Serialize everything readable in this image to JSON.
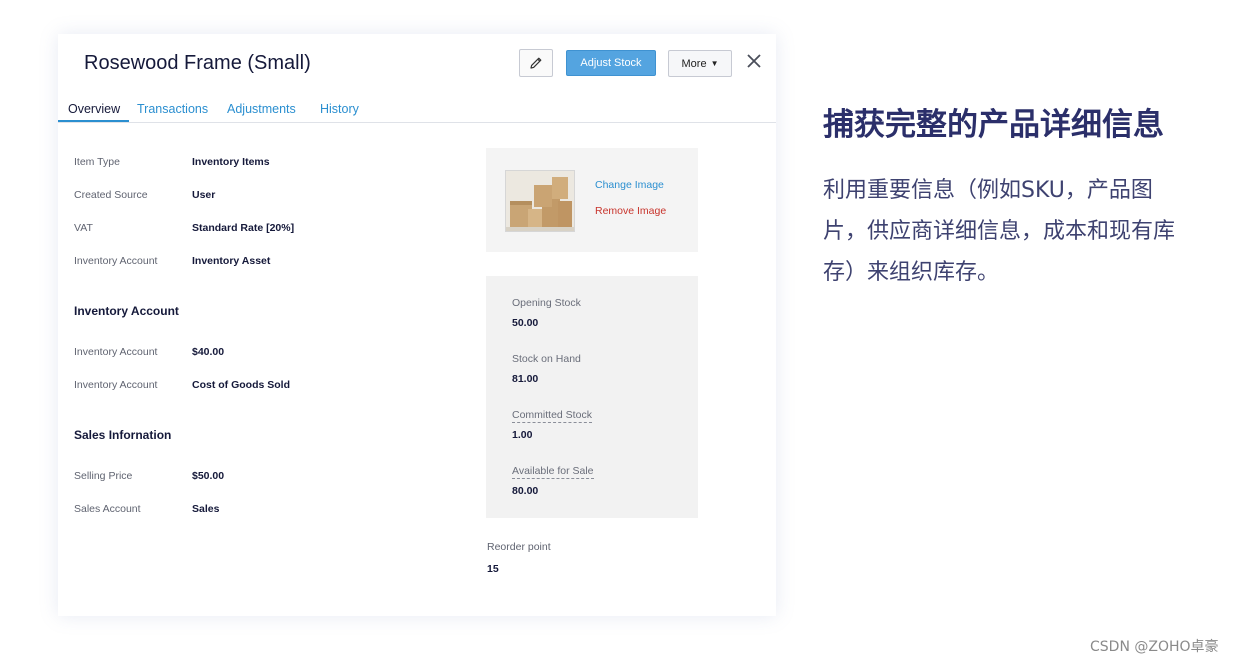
{
  "item": {
    "title": "Rosewood Frame (Small)",
    "adjust_stock_label": "Adjust Stock",
    "more_label": "More"
  },
  "tabs": [
    "Overview",
    "Transactions",
    "Adjustments",
    "History"
  ],
  "details": [
    {
      "label": "Item Type",
      "value": "Inventory Items"
    },
    {
      "label": "Created Source",
      "value": "User"
    },
    {
      "label": "VAT",
      "value": "Standard Rate [20%]"
    },
    {
      "label": "Inventory Account",
      "value": "Inventory Asset"
    }
  ],
  "inventory_section": {
    "title": "Inventory Account",
    "rows": [
      {
        "label": "Inventory Account",
        "value": "$40.00"
      },
      {
        "label": "Inventory Account",
        "value": "Cost of Goods Sold"
      }
    ]
  },
  "sales_section": {
    "title": "Sales Infornation",
    "rows": [
      {
        "label": "Selling Price",
        "value": "$50.00"
      },
      {
        "label": "Sales Account",
        "value": "Sales"
      }
    ]
  },
  "image_panel": {
    "change_label": "Change Image",
    "remove_label": "Remove Image"
  },
  "stock": [
    {
      "label": "Opening Stock",
      "value": "50.00"
    },
    {
      "label": "Stock on Hand",
      "value": "81.00"
    },
    {
      "label": "Committed Stock",
      "value": "1.00"
    },
    {
      "label": "Available for Sale",
      "value": "80.00"
    }
  ],
  "reorder": {
    "label": "Reorder point",
    "value": "15"
  },
  "promo": {
    "heading": "捕获完整的产品详细信息",
    "body_line1": "利用重要信息（例如SKU，产品图",
    "body_line2": "片，供应商详细信息，成本和现有库",
    "body_line3": "存）来组织库存。"
  },
  "watermark": "CSDN @ZOHO卓豪",
  "colors": {
    "accent": "#2b8fd0",
    "button": "#54a4e0",
    "remove": "#c8342c",
    "heading": "#2b2f6a"
  },
  "icons": {
    "edit": "pencil-icon",
    "close": "close-icon",
    "caret": "caret-down-icon"
  }
}
